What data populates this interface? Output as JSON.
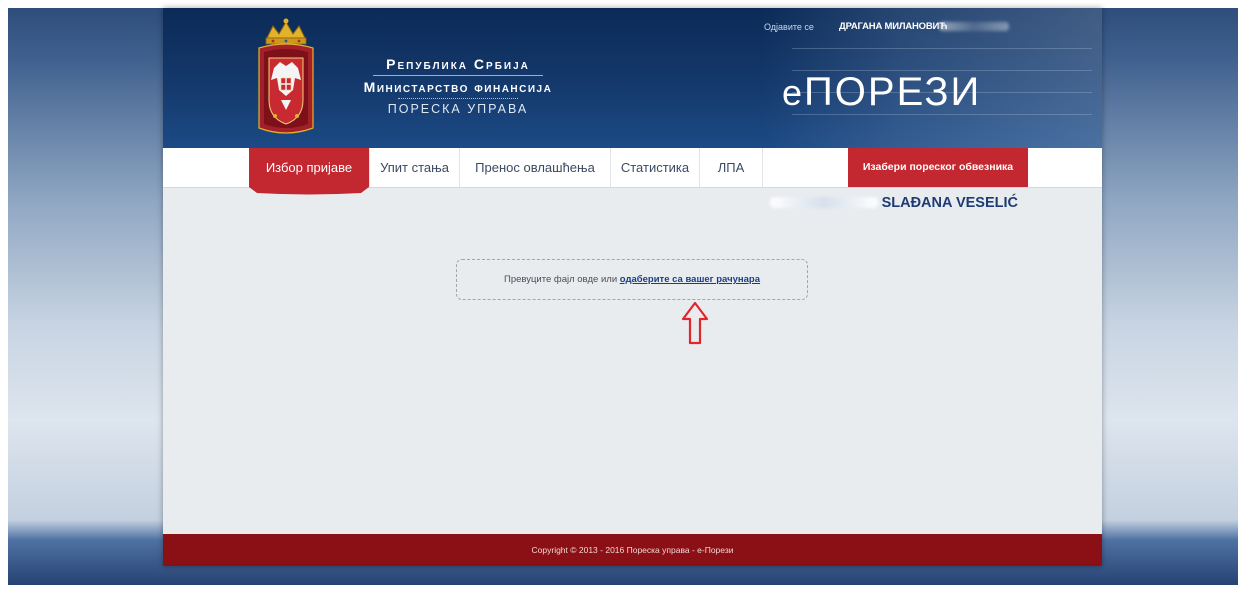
{
  "header": {
    "org_line1": "Република Србија",
    "org_line2": "Министарство финансија",
    "org_line3": "ПОРЕСКА УПРАВА",
    "logout_label": "Одјавите се",
    "username": "ДРАГАНА МИЛАНОВИЋ",
    "brand_prefix": "е",
    "brand_name": "ПОРЕЗИ"
  },
  "nav": {
    "items": [
      {
        "label": "Избор пријаве",
        "active": true
      },
      {
        "label": "Упит стања",
        "active": false
      },
      {
        "label": "Пренос овлашћења",
        "active": false
      },
      {
        "label": "Статистика",
        "active": false
      },
      {
        "label": "ЛПА",
        "active": false
      }
    ],
    "taxpayer_button": "Изабери пореског обвезника"
  },
  "taxpayer": {
    "name": "SLAĐANA VESELIĆ"
  },
  "dropzone": {
    "text": "Превуците фајл овде или",
    "link": "одаберите са вашег рачунара"
  },
  "footer": {
    "text": "Copyright © 2013 - 2016 Пореска управа - е-Порези"
  },
  "colors": {
    "header_blue": "#14396c",
    "accent_red": "#c3272f",
    "footer_red": "#8a1015",
    "link_blue": "#1a3e84",
    "annotation_arrow": "#e2262b"
  },
  "icons": {
    "coat_of_arms": "serbia-coat-of-arms-icon",
    "annotation": "up-arrow-outline-icon"
  }
}
